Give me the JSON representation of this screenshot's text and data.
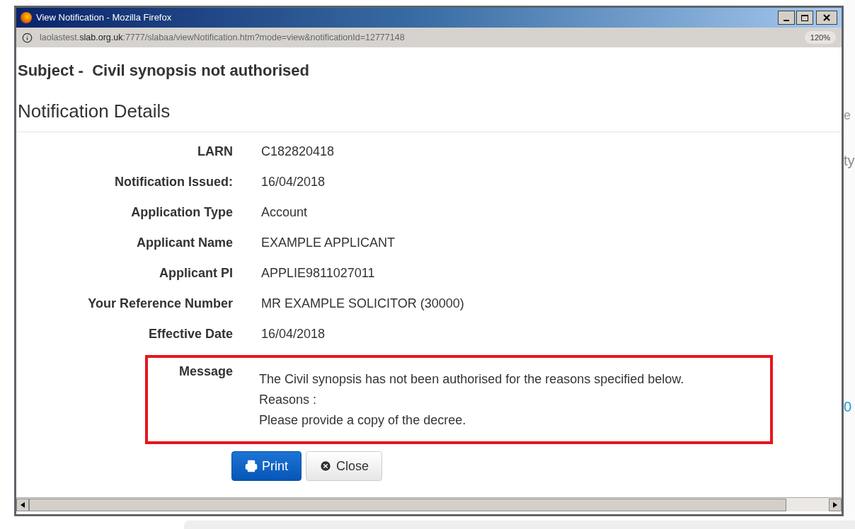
{
  "background_page": {
    "fragments": [
      "e",
      "ty",
      "0"
    ]
  },
  "window": {
    "title": "View Notification - Mozilla Firefox",
    "url_host_prefix": "laolastest.",
    "url_host_domain": "slab.org.uk",
    "url_rest": ":7777/slabaa/viewNotification.htm?mode=view&notificationId=12777148",
    "zoom": "120%"
  },
  "subject": {
    "label": "Subject - ",
    "text": "Civil synopsis not authorised"
  },
  "heading": "Notification Details",
  "fields": [
    {
      "label": "LARN",
      "value": "C182820418"
    },
    {
      "label": "Notification Issued:",
      "value": "16/04/2018"
    },
    {
      "label": "Application Type",
      "value": "Account"
    },
    {
      "label": "Applicant Name",
      "value": "EXAMPLE APPLICANT"
    },
    {
      "label": "Applicant PI",
      "value": "APPLIE9811027011"
    },
    {
      "label": "Your Reference Number",
      "value": "MR EXAMPLE SOLICITOR (30000)"
    },
    {
      "label": "Effective Date",
      "value": "16/04/2018"
    }
  ],
  "message": {
    "label": "Message",
    "lines": [
      "The Civil synopsis has not been authorised for the reasons specified below.",
      "Reasons :",
      "Please provide a copy of the decree."
    ]
  },
  "buttons": [
    {
      "kind": "primary",
      "label": "Print"
    },
    {
      "kind": "default",
      "label": "Close"
    }
  ]
}
